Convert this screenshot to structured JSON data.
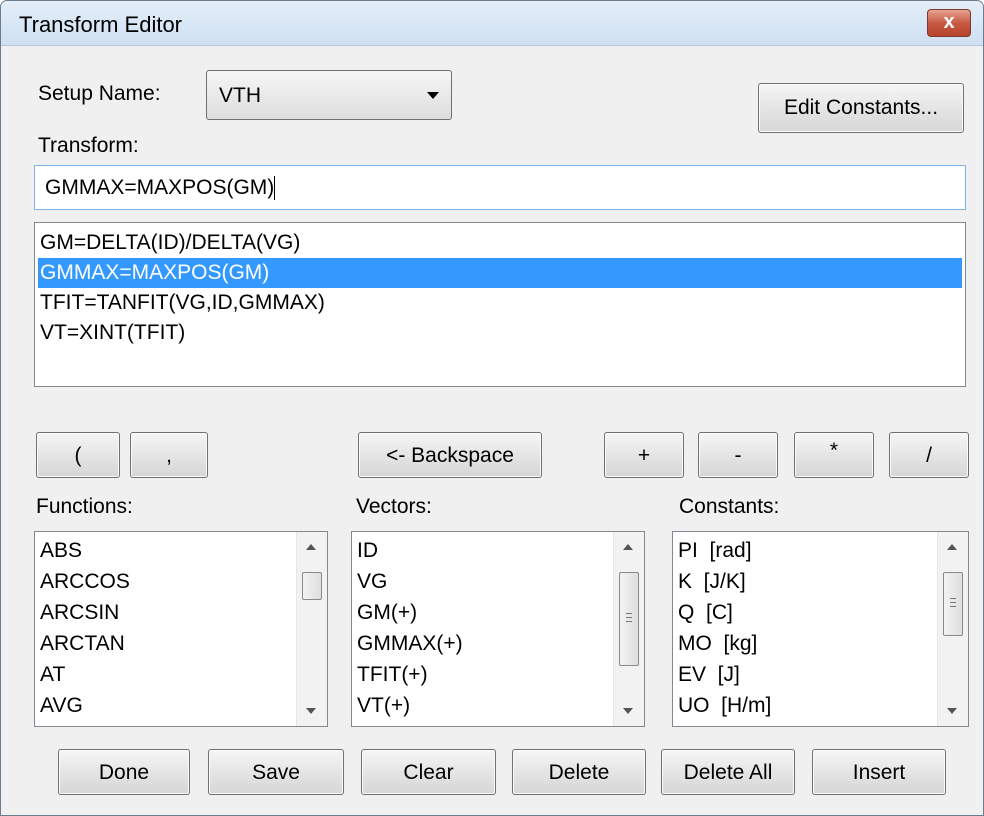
{
  "window": {
    "title": "Transform Editor",
    "close_label": "x"
  },
  "setup": {
    "label": "Setup Name:",
    "value": "VTH"
  },
  "edit_constants_label": "Edit Constants...",
  "transform": {
    "label": "Transform:",
    "value": "GMMAX=MAXPOS(GM)"
  },
  "transforms_list": [
    "GM=DELTA(ID)/DELTA(VG)",
    "GMMAX=MAXPOS(GM)",
    "TFIT=TANFIT(VG,ID,GMMAX)",
    "VT=XINT(TFIT)"
  ],
  "selected_transform_index": 1,
  "operators": {
    "open_paren": "(",
    "comma": ",",
    "backspace": "<- Backspace",
    "plus": "+",
    "minus": "-",
    "multiply": "*",
    "divide": "/"
  },
  "functions": {
    "label": "Functions:",
    "items": [
      "ABS",
      "ARCCOS",
      "ARCSIN",
      "ARCTAN",
      "AT",
      "AVG"
    ]
  },
  "vectors": {
    "label": "Vectors:",
    "items": [
      "ID",
      "VG",
      "GM(+)",
      "GMMAX(+)",
      "TFIT(+)",
      "VT(+)"
    ]
  },
  "constants": {
    "label": "Constants:",
    "items": [
      "PI  [rad]",
      "K  [J/K]",
      "Q  [C]",
      "MO  [kg]",
      "EV  [J]",
      "UO  [H/m]"
    ]
  },
  "actions": {
    "done": "Done",
    "save": "Save",
    "clear": "Clear",
    "delete": "Delete",
    "delete_all": "Delete All",
    "insert": "Insert"
  },
  "colors": {
    "selection": "#3399ff",
    "close_button": "#c75a43",
    "titlebar": "#dbe7f4"
  }
}
